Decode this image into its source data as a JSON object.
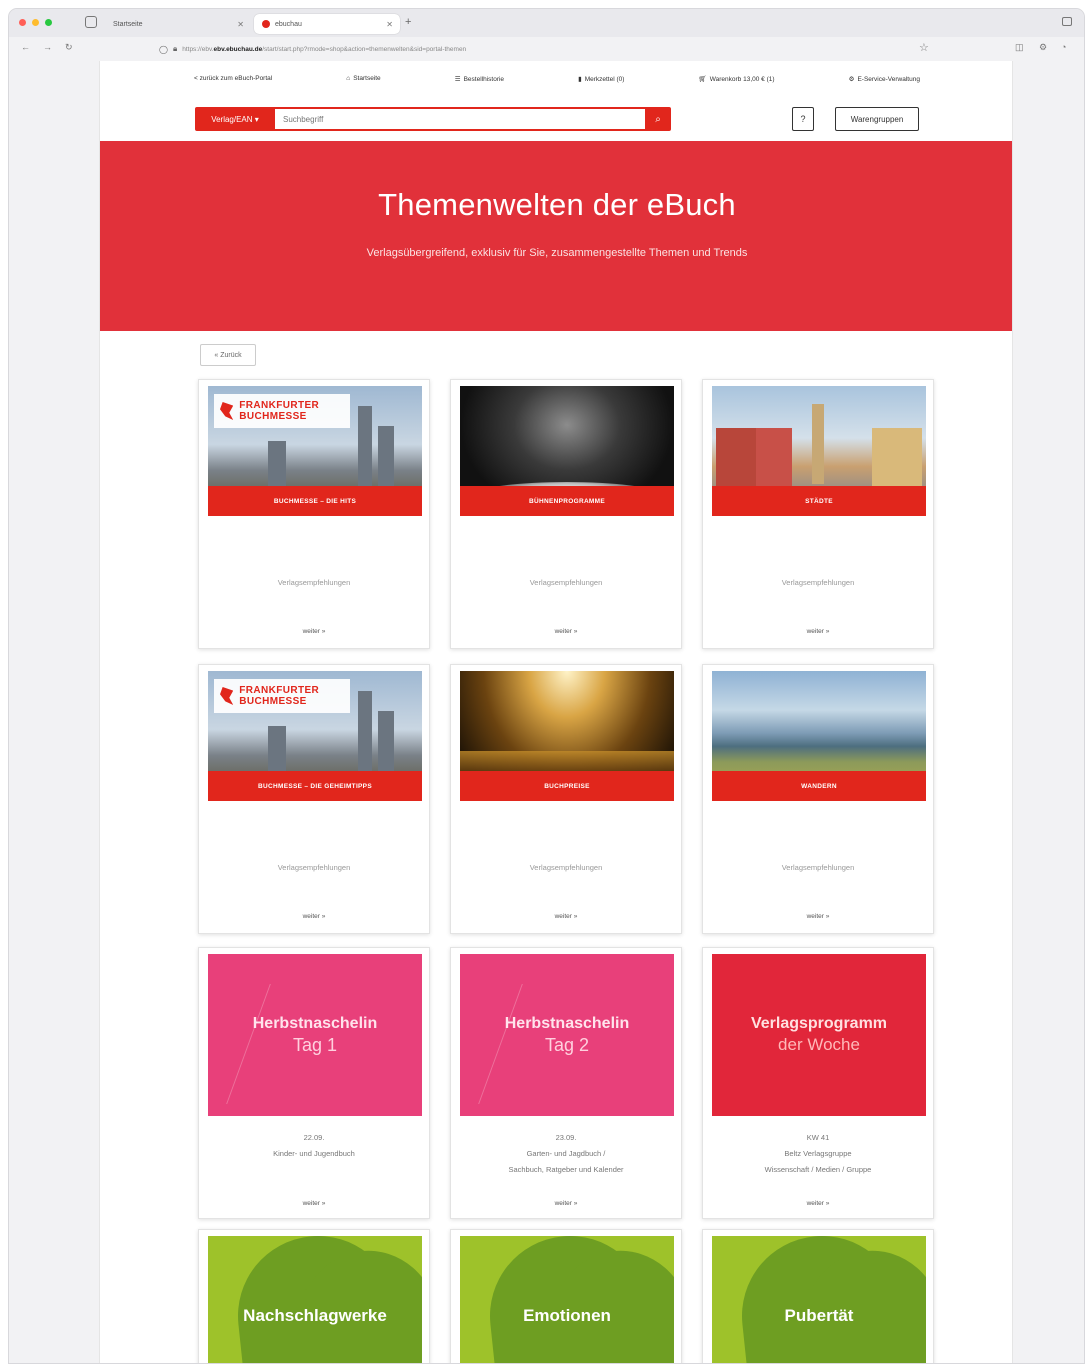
{
  "browser": {
    "tabs": [
      {
        "label": "Startseite"
      },
      {
        "label": "ebuchau"
      }
    ],
    "url_host": "ebv.ebuchau.de",
    "url_path": "/start/start.php?rmode=shop&action=themenwelten&sid=portal-themen",
    "url_prefix": "https://ebv."
  },
  "topnav": {
    "back_portal": "< zurück zum eBuch-Portal",
    "startseite": "Startseite",
    "bestellhistorie": "Bestellhistorie",
    "merkzettel": "Merkzettel (0)",
    "warenkorb": "Warenkorb 13,00 € (1)",
    "service": "E-Service-Verwaltung"
  },
  "search": {
    "scope_label": "Verlag/EAN",
    "placeholder": "Suchbegriff",
    "help_label": "?",
    "warengruppen_label": "Warengruppen"
  },
  "hero": {
    "title": "Themenwelten der eBuch",
    "subtitle": "Verlagsübergreifend, exklusiv für Sie, zusammengestellte Themen und Trends"
  },
  "back_button": "« Zurück",
  "cards_row1": [
    {
      "bar": "BUCHMESSE – DIE HITS",
      "sub": "Verlagsempfehlungen",
      "more": "weiter »",
      "logo": "FRANKFURTER BUCHMESSE"
    },
    {
      "bar": "BÜHNENPROGRAMME",
      "sub": "Verlagsempfehlungen",
      "more": "weiter »"
    },
    {
      "bar": "STÄDTE",
      "sub": "Verlagsempfehlungen",
      "more": "weiter »"
    }
  ],
  "cards_row2": [
    {
      "bar": "BUCHMESSE – DIE GEHEIMTIPPS",
      "sub": "Verlagsempfehlungen",
      "more": "weiter »",
      "logo": "FRANKFURTER BUCHMESSE"
    },
    {
      "bar": "BUCHPREISE",
      "sub": "Verlagsempfehlungen",
      "more": "weiter »"
    },
    {
      "bar": "WANDERN",
      "sub": "Verlagsempfehlungen",
      "more": "weiter »"
    }
  ],
  "cards_row3": [
    {
      "title": "Herbstnaschelin",
      "subtitle": "Tag 1",
      "line1": "22.09.",
      "line2": "Kinder- und Jugendbuch",
      "line3": "",
      "more": "weiter »"
    },
    {
      "title": "Herbstnaschelin",
      "subtitle": "Tag 2",
      "line1": "23.09.",
      "line2": "Garten- und Jagdbuch /",
      "line3": "Sachbuch, Ratgeber und Kalender",
      "more": "weiter »"
    },
    {
      "title": "Verlagsprogramm",
      "subtitle": "der Woche",
      "line1": "KW 41",
      "line2": "Beltz Verlagsgruppe",
      "line3": "Wissenschaft / Medien / Gruppe",
      "more": "weiter »"
    }
  ],
  "cards_row4": [
    {
      "label": "Nachschlagwerke"
    },
    {
      "label": "Emotionen"
    },
    {
      "label": "Pubertät"
    }
  ],
  "colors": {
    "brand_red": "#e1261c",
    "hero_red": "#e1313a",
    "pink": "#e8407a",
    "green": "#9ec22a"
  }
}
